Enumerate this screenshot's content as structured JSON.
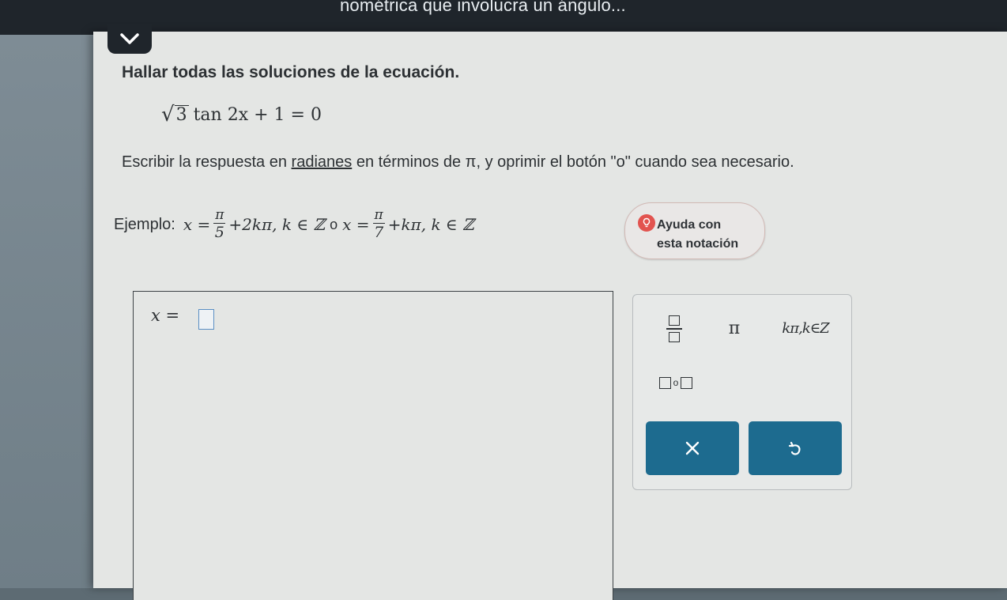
{
  "header": {
    "title": "nométrica que involucra un ángulo..."
  },
  "problem": {
    "statement": "Hallar todas las soluciones de la ecuación.",
    "equation": {
      "radicand": "3",
      "rest": "tan 2x + 1 = 0"
    },
    "instructions_pre": "Escribir la respuesta en ",
    "instructions_term": "radianes",
    "instructions_post": " en términos de π, y oprimir el botón \"o\" cuando sea necesario."
  },
  "example": {
    "label": "Ejemplo:",
    "expr1_lhs": "x =",
    "frac1_num": "π",
    "frac1_den": "5",
    "expr1_rest": "+2kπ, k ∈ ℤ",
    "separator": "o",
    "expr2_lhs": "x =",
    "frac2_num": "π",
    "frac2_den": "7",
    "expr2_rest": "+kπ, k ∈ ℤ"
  },
  "help": {
    "line1": "Ayuda con",
    "line2": "esta notación",
    "icon": "lightbulb-icon"
  },
  "answer": {
    "label": "x ="
  },
  "keypad": {
    "pi_label": "π",
    "kpi_label": "kπ,k∈Z",
    "or_label": "o",
    "accent": "#1d6b8f"
  }
}
